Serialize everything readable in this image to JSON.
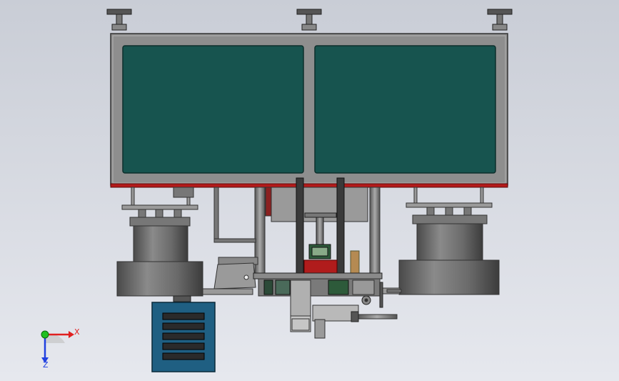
{
  "viewport": {
    "background_top": "#c9cdd6",
    "background_bottom": "#e6e8ee"
  },
  "colors": {
    "frame": "#8c8c8c",
    "panel": "#17544f",
    "red_strip": "#b41a1a",
    "cylinder": "#6f6f6f",
    "cabinet": "#1f5f82",
    "dark": "#2a2a2a"
  },
  "triad": {
    "x_label": "X",
    "z_label": "Z",
    "x_color": "#e02020",
    "y_color": "#20c020",
    "z_color": "#2040e0"
  }
}
